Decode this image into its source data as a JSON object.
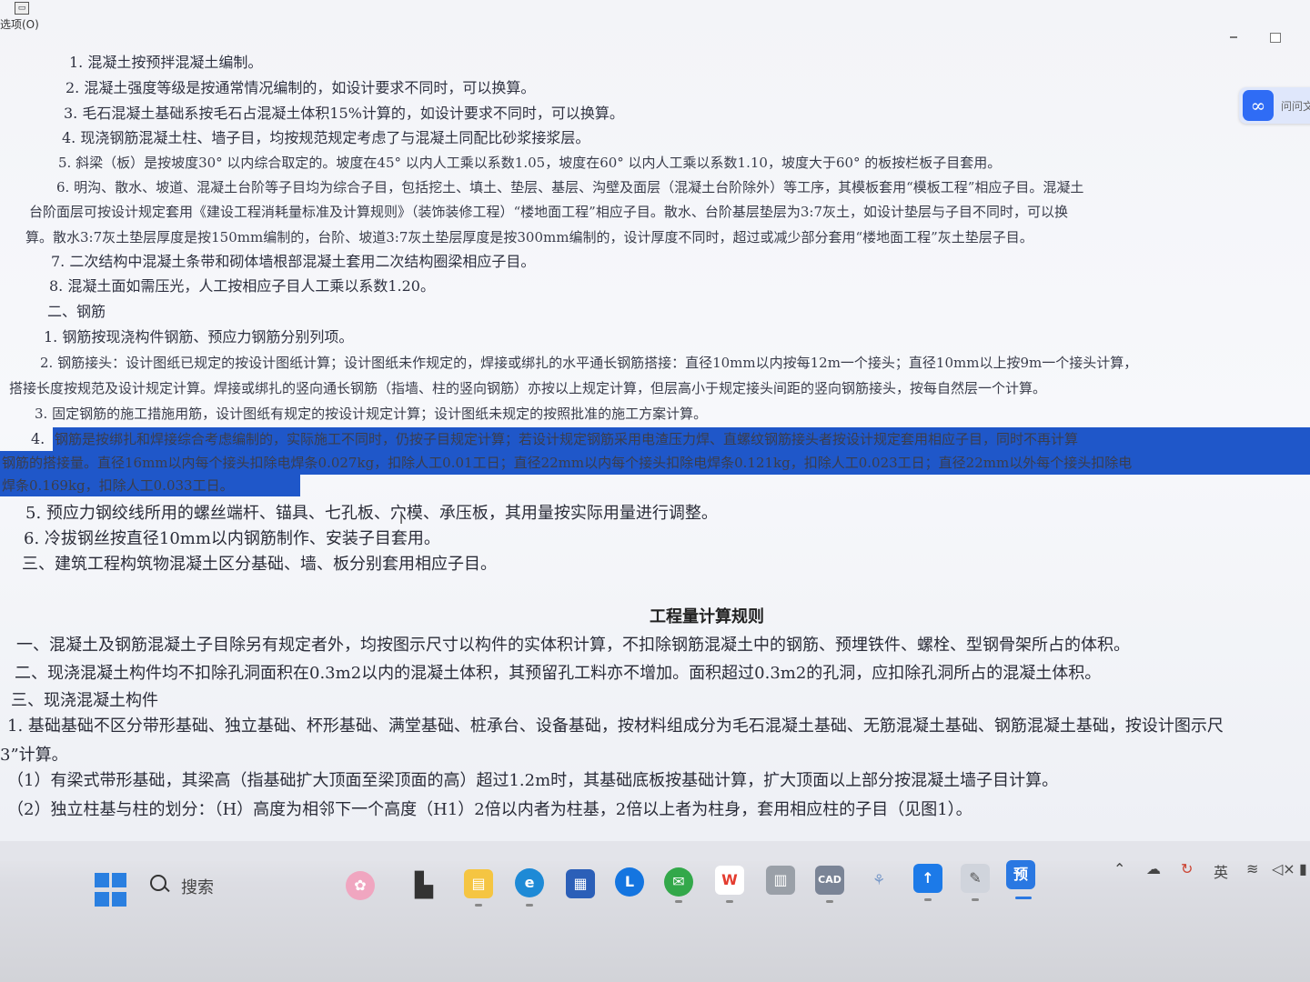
{
  "window": {
    "menu_options": "选项(O)",
    "assistant_label": "问问文"
  },
  "doc": {
    "lines": [
      "1. 混凝土按预拌混凝土编制。",
      "2. 混凝土强度等级是按通常情况编制的，如设计要求不同时，可以换算。",
      "3. 毛石混凝土基础系按毛石占混凝土体积15%计算的，如设计要求不同时，可以换算。",
      "4. 现浇钢筋混凝土柱、墙子目，均按规范规定考虑了与混凝土同配比砂浆接浆层。",
      "5. 斜梁（板）是按坡度30° 以内综合取定的。坡度在45° 以内人工乘以系数1.05，坡度在60° 以内人工乘以系数1.10，坡度大于60° 的板按栏板子目套用。",
      "6. 明沟、散水、坡道、混凝土台阶等子目均为综合子目，包括挖土、填土、垫层、基层、沟壁及面层（混凝土台阶除外）等工序，其模板套用“模板工程”相应子目。混凝土",
      "台阶面层可按设计规定套用《建设工程消耗量标准及计算规则》（装饰装修工程）“楼地面工程”相应子目。散水、台阶基层垫层为3:7灰土，如设计垫层与子目不同时，可以换",
      "算。散水3:7灰土垫层厚度是按150mm编制的，台阶、坡道3:7灰土垫层厚度是按300mm编制的，设计厚度不同时，超过或减少部分套用“楼地面工程”灰土垫层子目。",
      "7. 二次结构中混凝土条带和砌体墙根部混凝土套用二次结构圈梁相应子目。",
      "8. 混凝土面如需压光，人工按相应子目人工乘以系数1.20。",
      "二、钢筋",
      "1. 钢筋按现浇构件钢筋、预应力钢筋分别列项。",
      "2. 钢筋接头：设计图纸已规定的按设计图纸计算；设计图纸未作规定的，焊接或绑扎的水平通长钢筋搭接：直径10mm以内按每12m一个接头；直径10mm以上按9m一个接头计算，",
      "搭接长度按规范及设计规定计算。焊接或绑扎的竖向通长钢筋（指墙、柱的竖向钢筋）亦按以上规定计算，但层高小于规定接头间距的竖向钢筋接头，按每自然层一个计算。",
      "3. 固定钢筋的施工措施用筋，设计图纸有规定的按设计规定计算；设计图纸未规定的按照批准的施工方案计算。",
      "4.",
      "钢筋是按绑扎和焊接综合考虑编制的，实际施工不同时，仍按子目规定计算；若设计规定钢筋采用电渣压力焊、直螺纹钢筋接头者按设计规定套用相应子目，同时不再计算",
      "钢筋的搭接量。直径16mm以内每个接头扣除电焊条0.027kg，扣除人工0.01工日；直径22mm以内每个接头扣除电焊条0.121kg，扣除人工0.023工日；直径22mm以外每个接头扣除电",
      "焊条0.169kg，扣除人工0.033工日。",
      "5. 预应力钢绞线所用的螺丝端杆、锚具、七孔板、穴模、承压板，其用量按实际用量进行调整。",
      "6. 冷拔钢丝按直径10mm以内钢筋制作、安装子目套用。",
      "三、建筑工程构筑物混凝土区分基础、墙、板分别套用相应子目。",
      "工程量计算规则",
      "一、混凝土及钢筋混凝土子目除另有规定者外，均按图示尺寸以构件的实体积计算，不扣除钢筋混凝土中的钢筋、预埋铁件、螺栓、型钢骨架所占的体积。",
      "二、现浇混凝土构件均不扣除孔洞面积在0.3m2以内的混凝土体积，其预留孔工料亦不增加。面积超过0.3m2的孔洞，应扣除孔洞所占的混凝土体积。",
      "三、现浇混凝土构件",
      "1. 基础基础不区分带形基础、独立基础、杯形基础、满堂基础、桩承台、设备基础，按材料组成分为毛石混凝土基础、无筋混凝土基础、钢筋混凝土基础，按设计图示尺",
      "3”计算。",
      "（1）有梁式带形基础，其梁高（指基础扩大顶面至梁顶面的高）超过1.2m时，其基础底板按基础计算，扩大顶面以上部分按混凝土墙子目计算。",
      "（2）独立柱基与柱的划分：（H）高度为相邻下一个高度（H1）2倍以内者为柱基，2倍以上者为柱身，套用相应柱的子目（见图1）。"
    ]
  },
  "taskbar": {
    "search_label": "搜索",
    "tray_lang": "英"
  },
  "colors": {
    "selection": "#1f57c9",
    "start_blue": "#2a7fe0"
  }
}
